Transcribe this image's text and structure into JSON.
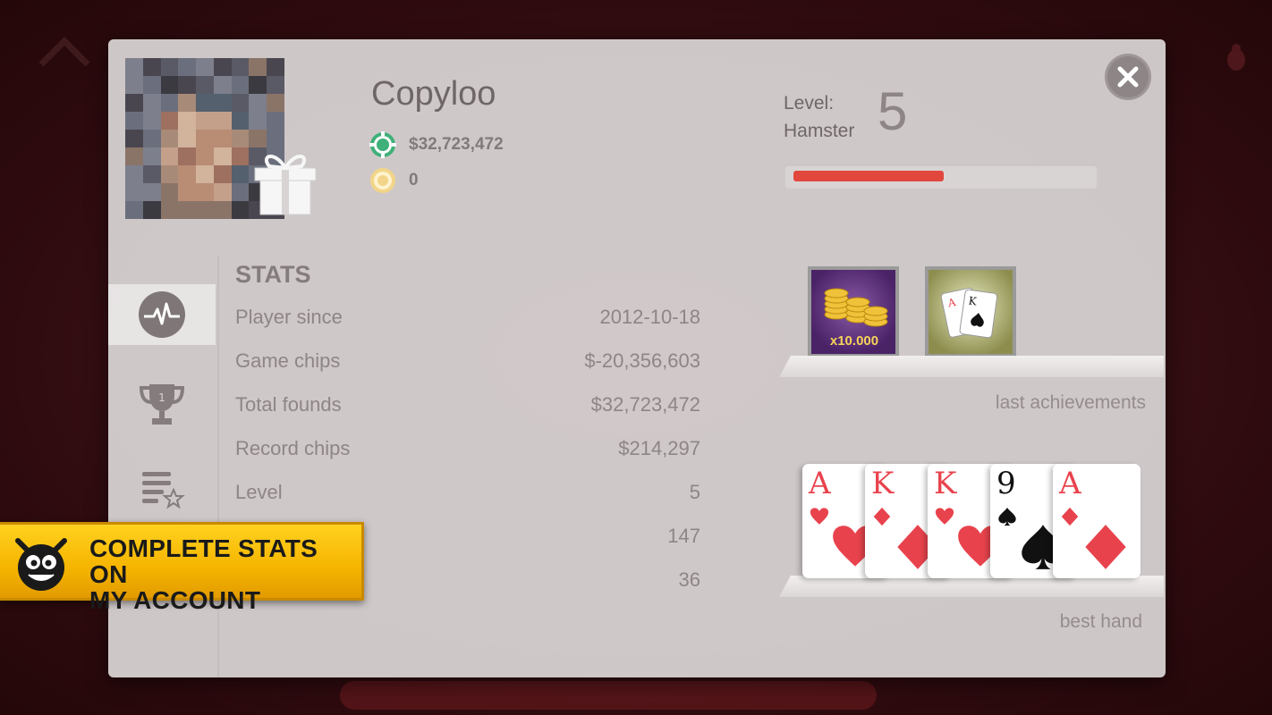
{
  "profile": {
    "name": "Copyloo",
    "chips": "$32,723,472",
    "gold": "0",
    "level_label_line1": "Level:",
    "level_label_line2": "Hamster",
    "level_value": "5",
    "level_progress": 0.51
  },
  "stats": {
    "title": "STATS",
    "rows": [
      {
        "label": "Player since",
        "value": "2012-10-18"
      },
      {
        "label": "Game chips",
        "value": "$-20,356,603"
      },
      {
        "label": "Total founds",
        "value": "$32,723,472"
      },
      {
        "label": "Record chips",
        "value": "$214,297"
      },
      {
        "label": "Level",
        "value": "5"
      },
      {
        "label": "",
        "value": "147"
      },
      {
        "label": "",
        "value": "36"
      }
    ]
  },
  "tabs": [
    {
      "icon": "pulse-icon",
      "active": true
    },
    {
      "icon": "trophy-icon",
      "active": false
    },
    {
      "icon": "list-star-icon",
      "active": false
    }
  ],
  "achievements": {
    "caption": "last achievements",
    "items": [
      {
        "icon": "gold-coins-icon",
        "text": "x10.000"
      },
      {
        "icon": "cards-icon"
      }
    ]
  },
  "best_hand": {
    "caption": "best hand",
    "cards": [
      {
        "rank": "A",
        "suit": "hearts"
      },
      {
        "rank": "K",
        "suit": "diamonds"
      },
      {
        "rank": "K",
        "suit": "hearts"
      },
      {
        "rank": "9",
        "suit": "spades"
      },
      {
        "rank": "A",
        "suit": "diamonds"
      }
    ]
  },
  "promo": {
    "line1": "COMPLETE STATS ON",
    "line2": "MY ACCOUNT"
  },
  "colors": {
    "accent": "#e2473d",
    "promo": "#f5b400",
    "modal": "#dad6d6"
  }
}
